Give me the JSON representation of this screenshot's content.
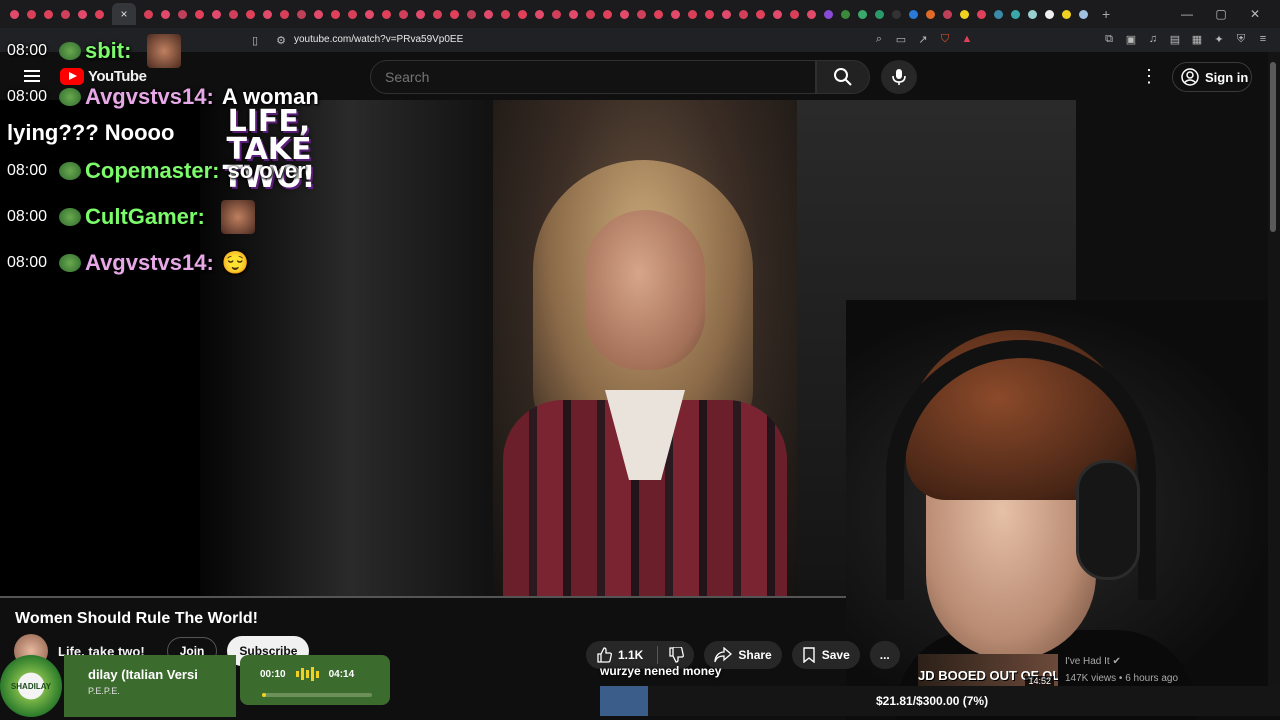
{
  "browser": {
    "url": "youtube.com/watch?v=PRva59Vp0EE",
    "tab_active_close": "×",
    "tab_new": "+"
  },
  "youtube": {
    "logo_text": "YouTube",
    "search_placeholder": "Search",
    "sign_in": "Sign in"
  },
  "video": {
    "overlay_text": "LIFE, TAKE TWO!",
    "title": "Women Should Rule The World!",
    "channel": "Life, take two!",
    "join": "Join",
    "subscribe": "Subscribe",
    "likes": "1.1K",
    "share": "Share",
    "save": "Save",
    "more": "..."
  },
  "chat": [
    {
      "time": "08:00",
      "user": "sbit:",
      "color": "#7CFC6B",
      "message": "",
      "emote": true
    },
    {
      "time": "08:00",
      "user": "Avgvstvs14:",
      "color": "#E6A8E6",
      "message": "A woman",
      "wrap": "lying??? Noooo"
    },
    {
      "time": "08:00",
      "user": "Copemaster:",
      "color": "#7CFC6B",
      "message": "so over"
    },
    {
      "time": "08:00",
      "user": "CultGamer:",
      "color": "#7CFC6B",
      "message": "",
      "emote": true
    },
    {
      "time": "08:00",
      "user": "Avgvstvs14:",
      "color": "#E6A8E6",
      "message": "😌"
    }
  ],
  "stream": {
    "donation_text": "wurzye nened money",
    "goal_text": "$21.81/$300.00 (7%)",
    "goal_fraction": 0.07,
    "music_logo": "SHADILAY",
    "music_title": "dilay (Italian Versi",
    "music_artist": "P.E.P.E.",
    "music_elapsed": "00:10",
    "music_total": "04:14",
    "music_fraction": 0.04
  },
  "recommendation": {
    "thumb_text": "JD BOOED OUT OF OLYMPI",
    "duration": "14:52",
    "channel": "I've Had It",
    "views": "147K views",
    "age": "6 hours ago"
  },
  "tab_colors": [
    "#e24a6c",
    "#d8405a",
    "#e0405a",
    "#d0405a",
    "#e24a6c",
    "#e0405a",
    "#d8405a",
    "#e24a6c",
    "#c0405a",
    "#e0405a",
    "#e24a6c",
    "#d0405a",
    "#e0405a",
    "#e24a6c",
    "#d8405a",
    "#c0405a",
    "#e24a6c",
    "#e0405a",
    "#d8405a",
    "#e24a6c",
    "#e0405a",
    "#d0405a",
    "#e24a6c",
    "#d8405a",
    "#e0405a",
    "#c0405a",
    "#e24a6c",
    "#d8405a",
    "#e0405a",
    "#e24a6c",
    "#d0405a",
    "#e24a6c",
    "#d8405a",
    "#e0405a",
    "#e24a6c",
    "#d0405a",
    "#e0405a",
    "#e24a6c",
    "#d8405a",
    "#e0405a",
    "#e24a6c",
    "#d0405a",
    "#e0405a",
    "#e24a6c",
    "#d8405a",
    "#e24a6c",
    "#8a4ad8",
    "#3a8a3a",
    "#3aa86a",
    "#2a9a6a",
    "#333333",
    "#2a7ad8",
    "#e06a2a",
    "#c0405a",
    "#f0d020",
    "#e0405a",
    "#3a8aa8",
    "#3aa8a8",
    "#9ad0d0",
    "#f0f0f0",
    "#f0d020",
    "#a0c0e0"
  ]
}
